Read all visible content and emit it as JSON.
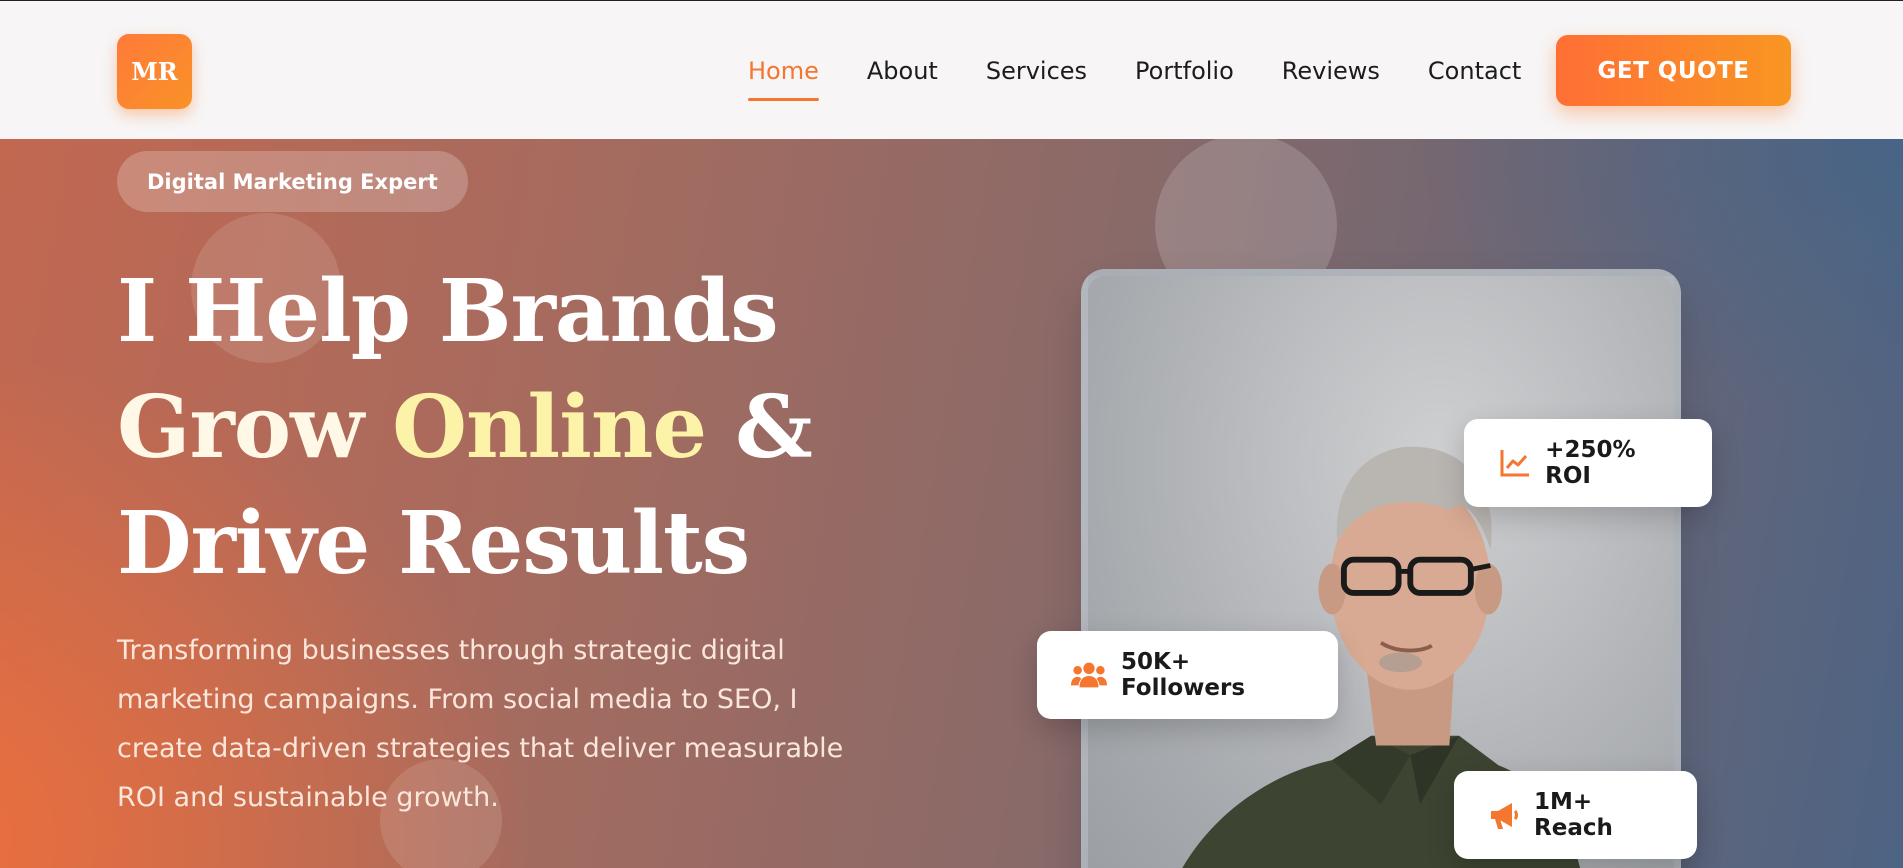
{
  "brand": {
    "logo_text": "MR",
    "accent": "#f4762f"
  },
  "nav": {
    "items": [
      {
        "label": "Home",
        "active": true
      },
      {
        "label": "About",
        "active": false
      },
      {
        "label": "Services",
        "active": false
      },
      {
        "label": "Portfolio",
        "active": false
      },
      {
        "label": "Reviews",
        "active": false
      },
      {
        "label": "Contact",
        "active": false
      }
    ],
    "cta_label": "GET QUOTE"
  },
  "hero": {
    "badge": "Digital Marketing Expert",
    "headline": {
      "line1": "I Help Brands",
      "line2_a": "Grow ",
      "line2_b": "Online",
      "line2_c": " &",
      "line3": "Drive Results"
    },
    "description": "Transforming businesses through strategic digital marketing campaigns. From social media to SEO, I create data-driven strategies that deliver measurable ROI and sustainable growth."
  },
  "stats": {
    "roi": {
      "icon": "chart-line-icon",
      "label": "+250% ROI"
    },
    "followers": {
      "icon": "users-icon",
      "label": "50K+ Followers"
    },
    "reach": {
      "icon": "megaphone-icon",
      "label": "1M+ Reach"
    }
  }
}
